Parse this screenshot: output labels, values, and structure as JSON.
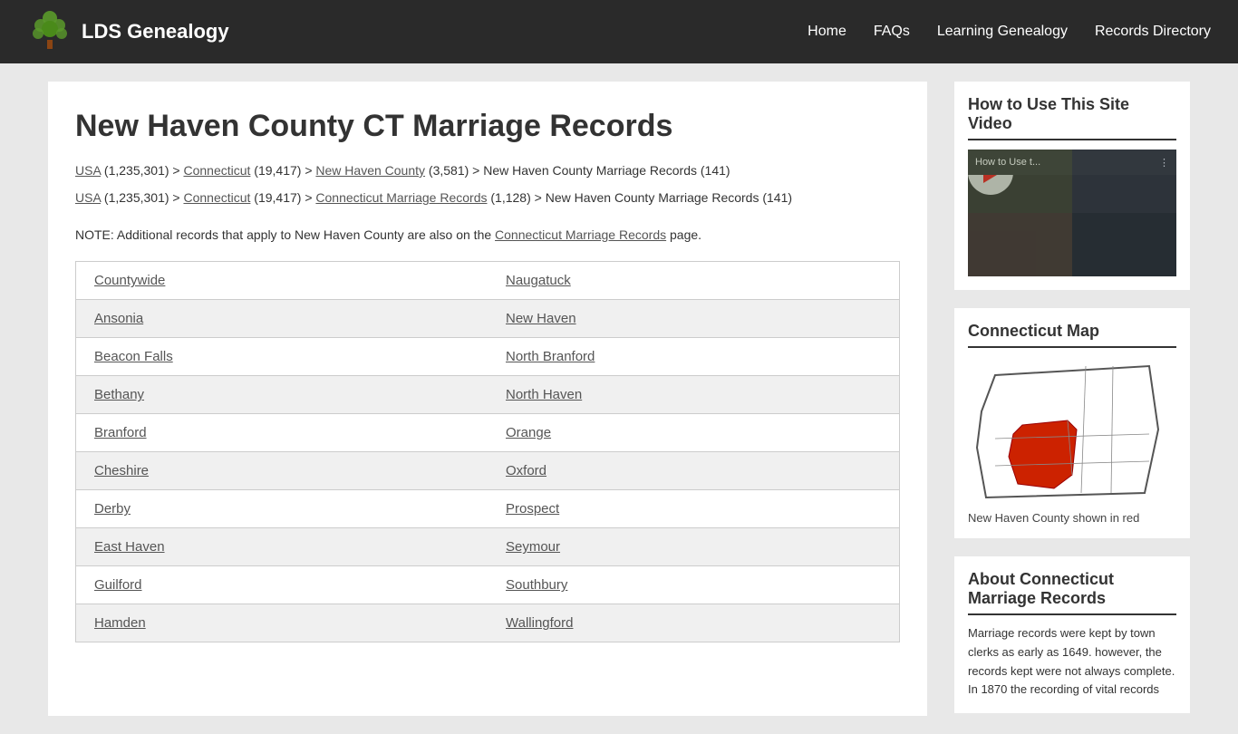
{
  "header": {
    "logo_text": "LDS Genealogy",
    "nav_items": [
      "Home",
      "FAQs",
      "Learning Genealogy",
      "Records Directory"
    ]
  },
  "main": {
    "page_title": "New Haven County CT Marriage Records",
    "breadcrumbs": [
      {
        "line": "USA (1,235,301) > Connecticut (19,417) > New Haven County (3,581) > New Haven County Marriage Records (141)",
        "links": [
          "USA",
          "Connecticut",
          "New Haven County"
        ]
      },
      {
        "line": "USA (1,235,301) > Connecticut (19,417) > Connecticut Marriage Records (1,128) > New Haven County Marriage Records (141)",
        "links": [
          "USA",
          "Connecticut",
          "Connecticut Marriage Records"
        ]
      }
    ],
    "note": "NOTE: Additional records that apply to New Haven County are also on the Connecticut Marriage Records page.",
    "table_rows": [
      {
        "col1": "Countywide",
        "col2": "Naugatuck"
      },
      {
        "col1": "Ansonia",
        "col2": "New Haven"
      },
      {
        "col1": "Beacon Falls",
        "col2": "North Branford"
      },
      {
        "col1": "Bethany",
        "col2": "North Haven"
      },
      {
        "col1": "Branford",
        "col2": "Orange"
      },
      {
        "col1": "Cheshire",
        "col2": "Oxford"
      },
      {
        "col1": "Derby",
        "col2": "Prospect"
      },
      {
        "col1": "East Haven",
        "col2": "Seymour"
      },
      {
        "col1": "Guilford",
        "col2": "Southbury"
      },
      {
        "col1": "Hamden",
        "col2": "Wallingford"
      }
    ]
  },
  "sidebar": {
    "video_section_title": "How to Use This Site Video",
    "video_overlay_text": "How to Use t...",
    "map_section_title": "Connecticut Map",
    "map_caption": "New Haven County shown in red",
    "about_title": "About Connecticut Marriage Records",
    "about_text": "Marriage records were kept by town clerks as early as 1649. however, the records kept were not always complete. In 1870 the recording of vital records"
  }
}
